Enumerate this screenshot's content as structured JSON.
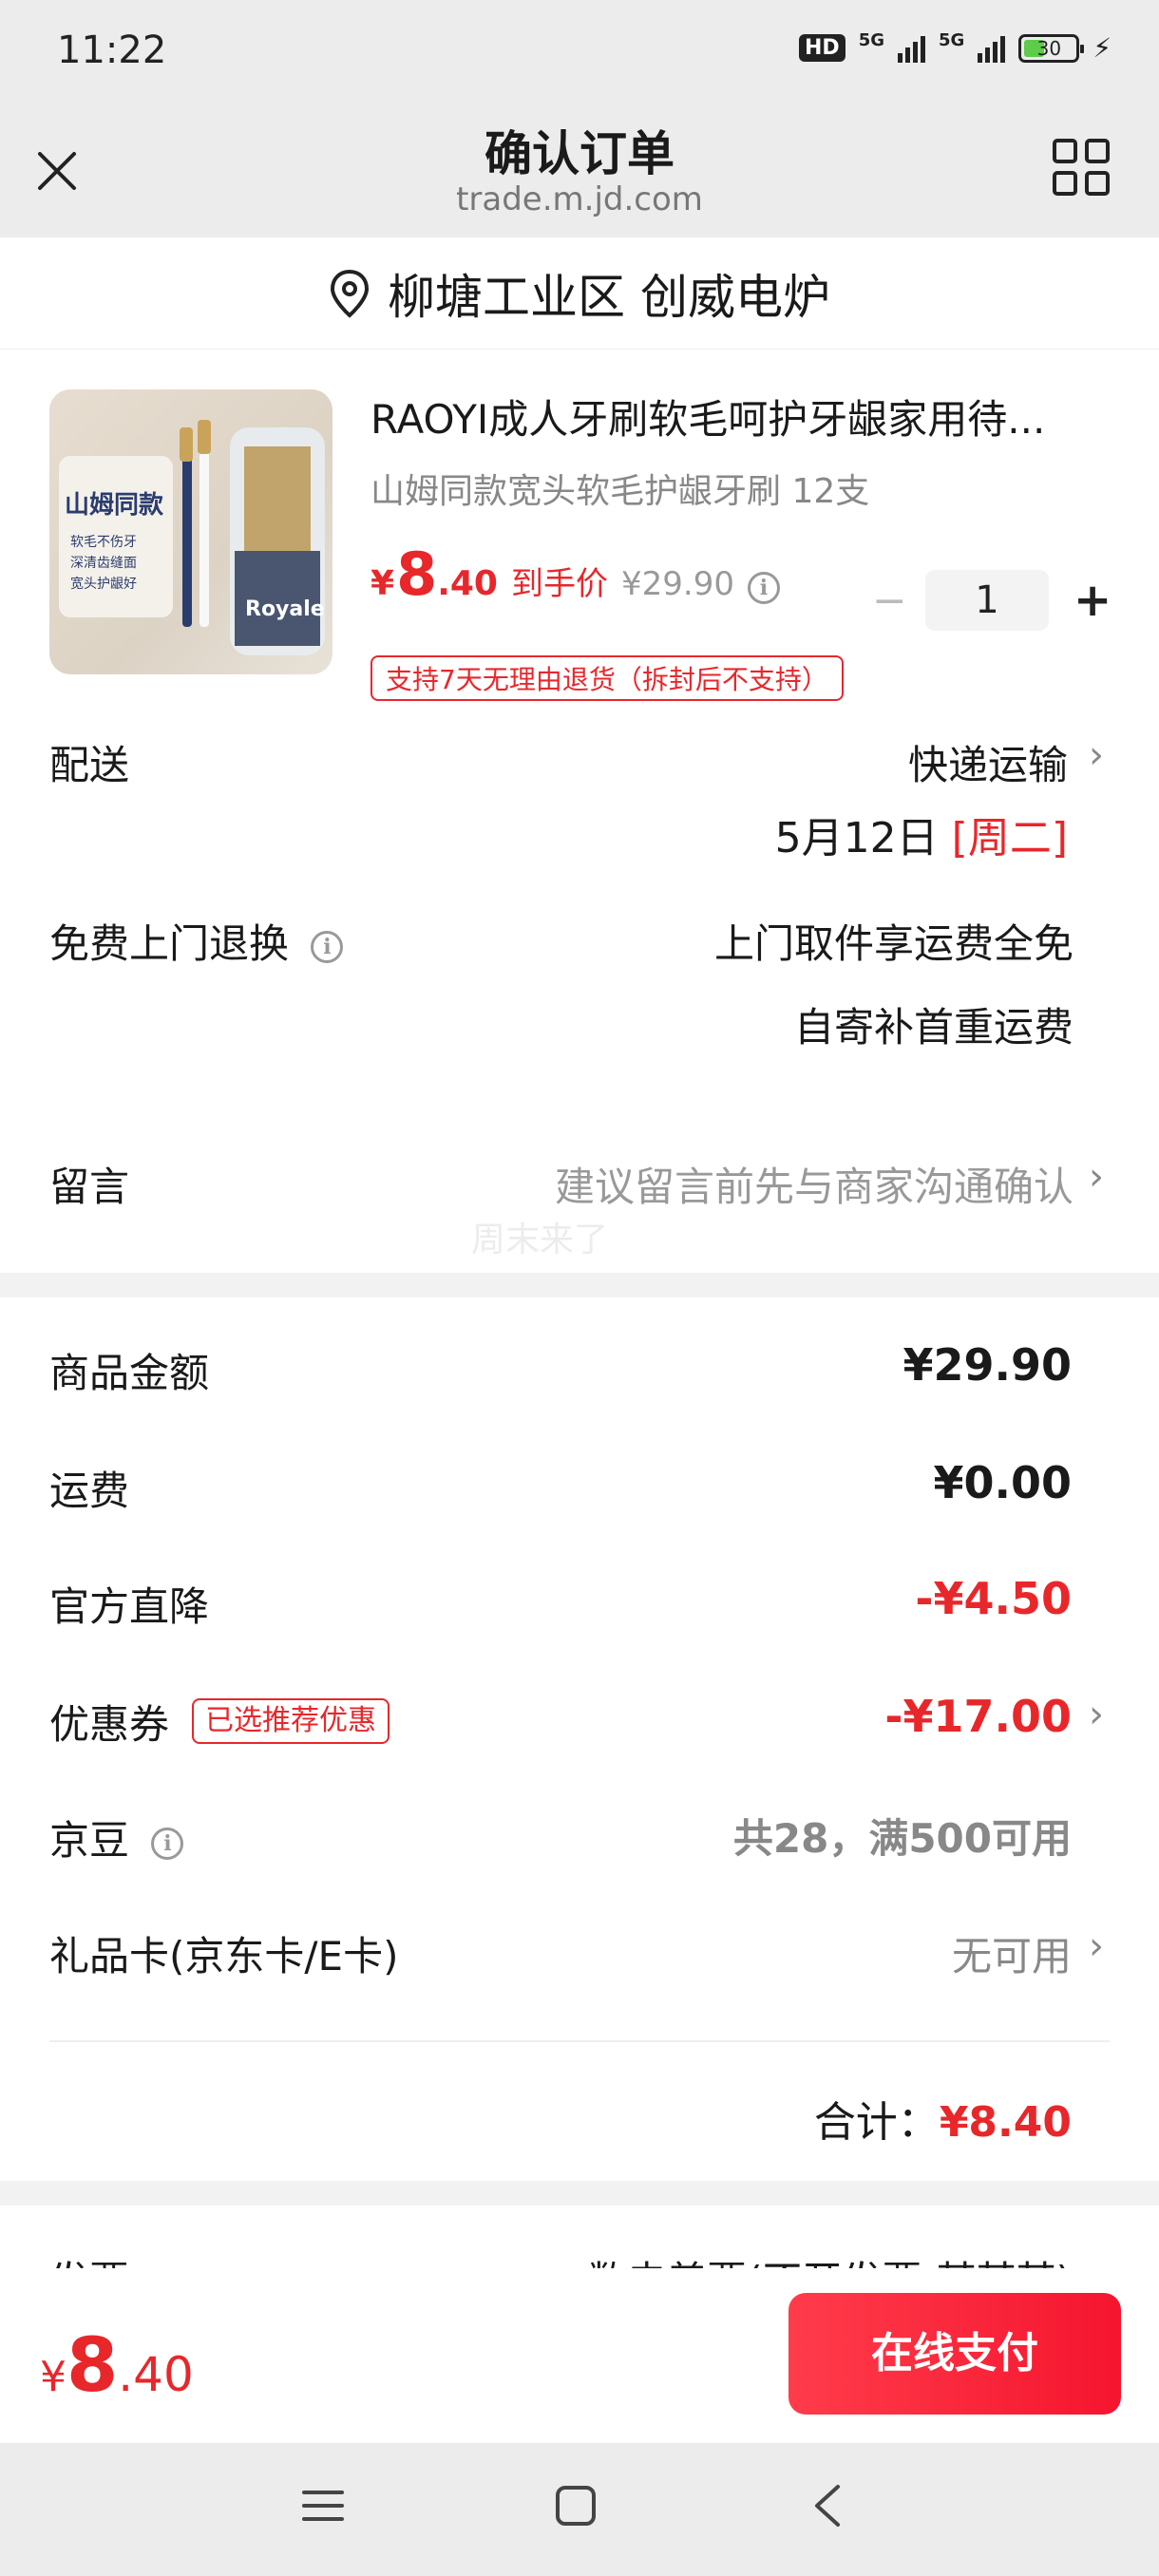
{
  "status_bar": {
    "time": "11:22",
    "hd": "HD",
    "net1": "5G",
    "net2": "5G",
    "battery": "30"
  },
  "header": {
    "title": "确认订单",
    "domain": "trade.m.jd.com"
  },
  "address": {
    "text": "柳塘工业区 创威电炉"
  },
  "product": {
    "title": "RAOYI成人牙刷软毛呵护牙龈家用待...",
    "subtitle": "山姆同款宽头软毛护龈牙刷 12支",
    "price_symbol": "¥",
    "price_int": "8",
    "price_dec": ".40",
    "price_label": "到手价",
    "original_price": "¥29.90",
    "quantity": "1",
    "return_tag": "支持7天无理由退货（拆封后不支持）",
    "image_text_main": "山姆同款",
    "image_text_lines": [
      "软毛不伤牙",
      "深清齿缝面",
      "宽头护龈好"
    ],
    "image_brand": "Royale"
  },
  "delivery": {
    "label": "配送",
    "method": "快递运输",
    "date": "5月12日",
    "weekday": "[周二]"
  },
  "free_return": {
    "label": "免费上门退换",
    "line1": "上门取件享运费全免",
    "line2": "自寄补首重运费"
  },
  "message": {
    "label": "留言",
    "placeholder": "建议留言前先与商家沟通确认",
    "watermark": "周末来了"
  },
  "summary": {
    "goods_label": "商品金额",
    "goods_value": "¥29.90",
    "shipping_label": "运费",
    "shipping_value": "¥0.00",
    "discount_label": "官方直降",
    "discount_value": "-¥4.50",
    "coupon_label": "优惠券",
    "coupon_tag": "已选推荐优惠",
    "coupon_value": "-¥17.00",
    "beans_label": "京豆",
    "beans_value": "共28，满500可用",
    "giftcard_label": "礼品卡(京东卡/E卡)",
    "giftcard_value": "无可用",
    "total_label": "合计：",
    "total_value": "¥8.40"
  },
  "invoice": {
    "label": "发票",
    "value": "数电普票(不开发票-某某某)"
  },
  "bottom": {
    "price_symbol": "¥",
    "price_int": "8",
    "price_dec": ".40",
    "pay_label": "在线支付"
  },
  "colors": {
    "accent": "#e8272b",
    "background": "#f2f2f2"
  }
}
